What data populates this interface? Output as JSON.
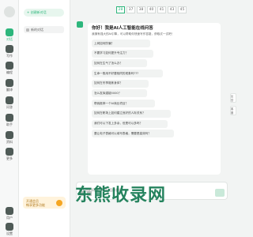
{
  "colors": {
    "accent": "#2db67c",
    "rail_bg": "#f7f8f8",
    "promo_bg": "#fff3dc",
    "watermark": "#127850"
  },
  "rail": {
    "items": [
      {
        "label": "对话",
        "icon": "chat-icon",
        "active": true
      },
      {
        "label": "写作",
        "icon": "pen-icon"
      },
      {
        "label": "编程",
        "icon": "code-icon"
      },
      {
        "label": "翻译",
        "icon": "translate-icon"
      },
      {
        "label": "问答",
        "icon": "question-icon"
      },
      {
        "label": "助手",
        "icon": "assistant-icon"
      },
      {
        "label": "资料",
        "icon": "book-icon"
      },
      {
        "label": "更多",
        "icon": "grid-icon"
      }
    ],
    "bottom": [
      {
        "label": "用户",
        "icon": "user-icon"
      },
      {
        "label": "设置",
        "icon": "gear-icon"
      }
    ]
  },
  "history": {
    "new_chat_label": "+ 创建新对话",
    "items": [
      "新的对话"
    ]
  },
  "promo": {
    "line1": "开通会员",
    "line2": "畅享更多功能"
  },
  "pagination": {
    "tabs": [
      "28",
      "37",
      "38",
      "40",
      "41",
      "43",
      "45"
    ],
    "active": "28"
  },
  "welcome": {
    "greeting": "你好！我是AI人工智能在线问答",
    "intro": "我拥有强大的AI引擎，可以帮助你快速写作答疑，获取试一试吧！"
  },
  "questions": [
    "上网如何防骗？",
    "不要学习如何提升专注力？",
    "如何在生气了怎么办？",
    "生命一般用不好要相同的现象吗???",
    "如何在冬季锻炼身体？",
    "怎么发挥潜能5000？",
    "帮我推荐一个AI商业项目？",
    "如何在职场上如何建立良好的人际关系？",
    "我们可以下发上多余，但是可以多吗？",
    "要让电子表格可以填写表格，需要是高效吗？"
  ],
  "input": {
    "placeholder": "输入您的问题，Ctrl+回车换行"
  },
  "watermark_text": "东熊收录网",
  "float_buttons": [
    "反馈",
    "客服"
  ]
}
